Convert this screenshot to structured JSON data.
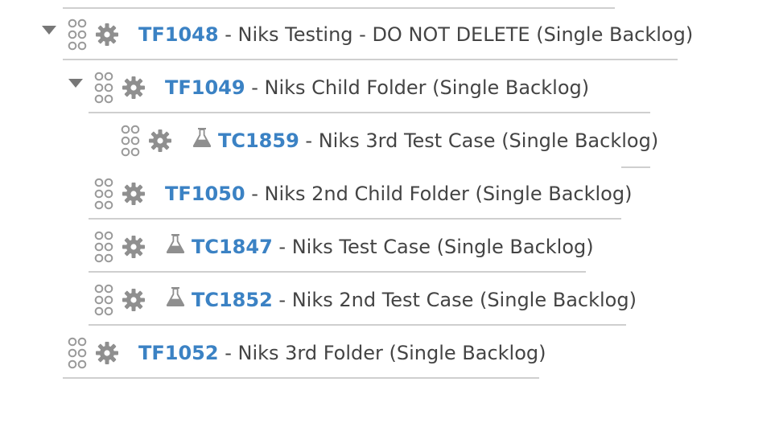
{
  "colors": {
    "link": "#3b82c4",
    "text": "#444444",
    "icon": "#8f8f8f",
    "rule": "#cfcfcf",
    "toggle": "#777777"
  },
  "tree": {
    "rows": [
      {
        "id": "TF1048",
        "title": "- Niks Testing - DO NOT DELETE (Single Backlog)",
        "kind": "folder",
        "expanded": true
      },
      {
        "id": "TF1049",
        "title": "- Niks Child Folder (Single Backlog)",
        "kind": "folder",
        "expanded": true
      },
      {
        "id": "TC1859",
        "title": "- Niks 3rd Test Case (Single Backlog)",
        "kind": "test-case"
      },
      {
        "id": "TF1050",
        "title": "- Niks 2nd Child Folder (Single Backlog)",
        "kind": "folder"
      },
      {
        "id": "TC1847",
        "title": "- Niks Test Case (Single Backlog)",
        "kind": "test-case"
      },
      {
        "id": "TC1852",
        "title": "- Niks 2nd Test Case (Single Backlog)",
        "kind": "test-case"
      },
      {
        "id": "TF1052",
        "title": "- Niks 3rd Folder (Single Backlog)",
        "kind": "folder"
      }
    ]
  },
  "icons": {
    "toggle": "expand-caret-icon",
    "drag": "drag-handle-icon",
    "settings": "gear-icon",
    "test_case": "flask-icon"
  }
}
